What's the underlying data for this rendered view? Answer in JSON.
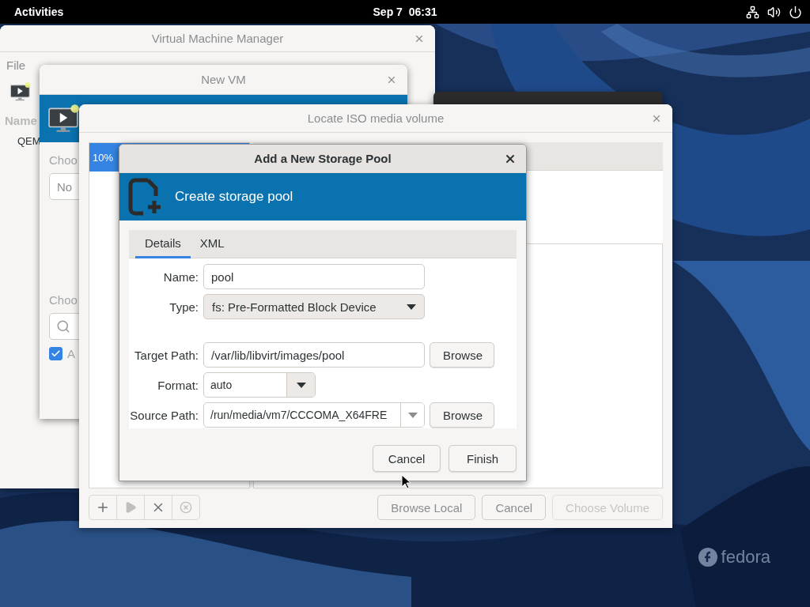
{
  "top_bar": {
    "activities": "Activities",
    "clock": "Sep 7  06:31"
  },
  "manager_window": {
    "title": "Virtual Machine Manager",
    "menu": [
      "File"
    ],
    "column_header": "Name",
    "rows": [
      "QEM"
    ]
  },
  "new_vm_window": {
    "title": "New VM",
    "label_1": "Choo",
    "combo_value": "No",
    "label_2": "Choo",
    "checkbox": {
      "label": "A",
      "checked": true
    }
  },
  "locate_window": {
    "title": "Locate ISO media volume",
    "pool_list": [
      {
        "usage": "10%",
        "selected": true
      }
    ],
    "tool_buttons": [
      {
        "kind": "add",
        "disabled": false
      },
      {
        "kind": "start",
        "disabled": true
      },
      {
        "kind": "delete",
        "disabled": false
      },
      {
        "kind": "stop",
        "disabled": true
      }
    ],
    "buttons": [
      {
        "label": "Browse Local",
        "disabled": false
      },
      {
        "label": "Cancel",
        "disabled": false
      },
      {
        "label": "Choose Volume",
        "disabled": true
      }
    ]
  },
  "dialog": {
    "title": "Add a New Storage Pool",
    "header": "Create storage pool",
    "tabs": [
      {
        "label": "Details",
        "selected": true
      },
      {
        "label": "XML",
        "selected": false
      }
    ],
    "fields": [
      {
        "kind": "text",
        "label": "Name:",
        "value": "pool"
      },
      {
        "kind": "select",
        "label": "Type:",
        "value": "fs: Pre-Formatted Block Device"
      },
      {
        "kind": "path",
        "label": "Target Path:",
        "value": "/var/lib/libvirt/images/pool",
        "button": "Browse"
      },
      {
        "kind": "combo",
        "label": "Format:",
        "value": "auto"
      },
      {
        "kind": "combo-path",
        "label": "Source Path:",
        "value": "/run/media/vm7/CCCOMA_X64FRE",
        "button": "Browse"
      }
    ],
    "buttons": [
      "Cancel",
      "Finish"
    ]
  },
  "brand": "fedora"
}
